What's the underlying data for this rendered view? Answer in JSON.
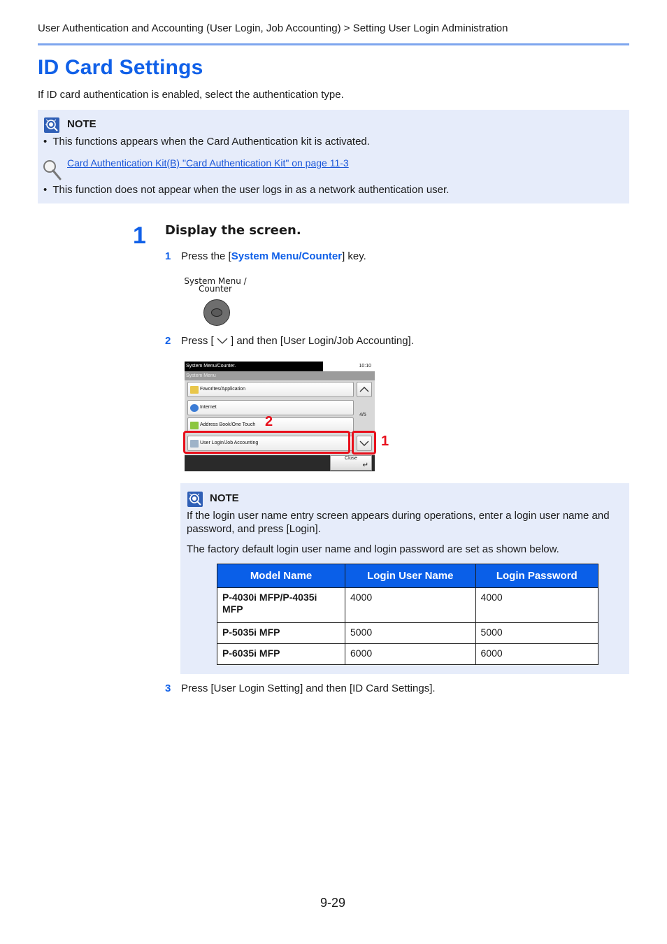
{
  "header": {
    "breadcrumb": "User Authentication and Accounting (User Login, Job Accounting) > Setting User Login Administration",
    "title": "ID Card Settings",
    "intro": "If ID card authentication is enabled, select the authentication type."
  },
  "note1": {
    "label": "NOTE",
    "bullet1": "This functions appears when the Card Authentication kit is activated.",
    "link": "Card Authentication Kit(B) \"Card Authentication Kit\" on page 11-3",
    "bullet2": "This function does not appear when the user logs in as a network authentication user.",
    "bullet_char": "•"
  },
  "step1": {
    "number": "1",
    "heading": "Display the screen.",
    "sub1": {
      "number": "1",
      "prefix": "Press the [",
      "keyword": "System Menu/Counter",
      "suffix": "] key."
    },
    "key_label_line1": "System Menu /",
    "key_label_line2": "Counter",
    "sub2": {
      "number": "2",
      "prefix": "Press [",
      "suffix": "] and then [User Login/Job Accounting]."
    },
    "sub3": {
      "number": "3",
      "text": "Press [User Login Setting] and then [ID Card Settings]."
    }
  },
  "panel": {
    "title": "System Menu/Counter.",
    "time": "10:10",
    "subtitle": "System Menu",
    "items": [
      {
        "label": "Favorites/Application",
        "icon_color": "#e8c64a"
      },
      {
        "label": "Internet",
        "icon_color": "#3a7bd5"
      },
      {
        "label": "Address Book/One Touch",
        "icon_color": "#8cc63f"
      },
      {
        "label": "User Login/Job Accounting",
        "icon_color": "#9fb3c8"
      }
    ],
    "page_indicator": "4/5",
    "close_label": "Close",
    "callout1": "1",
    "callout2": "2",
    "callout_color": "#e8101c"
  },
  "note2": {
    "label": "NOTE",
    "para1": "If the login user name entry screen appears during operations, enter a login user name and password, and press [Login].",
    "para2": "The factory default login user name and login password are set as shown below.",
    "table": {
      "headers": [
        "Model Name",
        "Login User Name",
        "Login Password"
      ],
      "rows": [
        [
          "P-4030i MFP/P-4035i MFP",
          "4000",
          "4000"
        ],
        [
          "P-5035i MFP",
          "5000",
          "5000"
        ],
        [
          "P-6035i MFP",
          "6000",
          "6000"
        ]
      ]
    }
  },
  "footer": {
    "page_number": "9-29"
  },
  "colors": {
    "accent": "#1060e8",
    "rule": "#7ea6ee",
    "note_bg": "#e6ecfa",
    "table_header": "#0a5fe8"
  }
}
